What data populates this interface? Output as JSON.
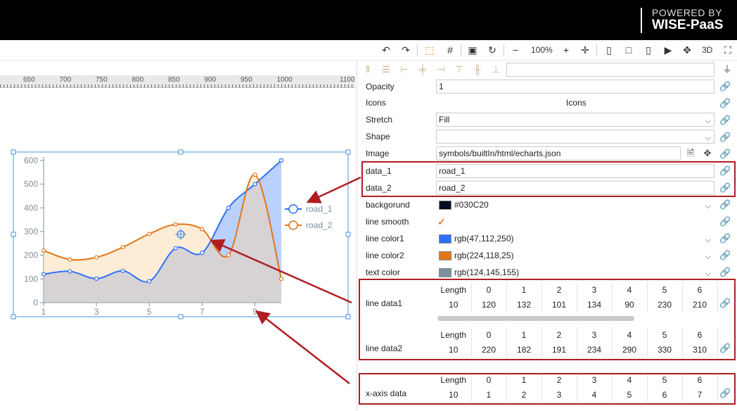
{
  "brand": {
    "line1": "POWERED BY",
    "line2": "WISE-PaaS"
  },
  "toolbar": {
    "undo_icon": "undo-icon",
    "redo_icon": "redo-icon",
    "zoom_label": "100%",
    "view3d_label": "3D"
  },
  "ruler": {
    "labels": [
      "650",
      "700",
      "750",
      "800",
      "850",
      "900",
      "950",
      "1000",
      "1100"
    ]
  },
  "chart_data": {
    "type": "area",
    "x": [
      1,
      2,
      3,
      4,
      5,
      6,
      7,
      8,
      9,
      10
    ],
    "xticks": [
      "1",
      "3",
      "5",
      "7",
      "9"
    ],
    "yticks": [
      "0",
      "100",
      "200",
      "300",
      "400",
      "500",
      "600"
    ],
    "ylim": [
      0,
      600
    ],
    "series": [
      {
        "name": "road_1",
        "color": "#2F70FA",
        "values": [
          120,
          132,
          101,
          134,
          90,
          230,
          210,
          400,
          500,
          600
        ]
      },
      {
        "name": "road_2",
        "color": "#E07619",
        "values": [
          220,
          182,
          191,
          234,
          290,
          330,
          310,
          200,
          540,
          100
        ]
      }
    ],
    "smooth": true,
    "legend": "right"
  },
  "panel": {
    "opacity_label": "Opacity",
    "opacity_value": "1",
    "icons_label": "Icons",
    "icons_value": "Icons",
    "stretch_label": "Stretch",
    "stretch_value": "Fill",
    "shape_label": "Shape",
    "shape_value": "",
    "image_label": "Image",
    "image_value": "symbols/builtIn/html/echarts.json",
    "data1_label": "data_1",
    "data1_value": "road_1",
    "data2_label": "data_2",
    "data2_value": "road_2",
    "bg_label": "backgorund",
    "bg_value": "#030C20",
    "bg_color": "#030C20",
    "smooth_label": "line smooth",
    "lc1_label": "line color1",
    "lc1_value": "rgb(47,112,250)",
    "lc1_color": "#2F70FA",
    "lc2_label": "line color2",
    "lc2_value": "rgb(224,118,25)",
    "lc2_color": "#E07619",
    "tc_label": "text color",
    "tc_value": "rgb(124,145,155)",
    "tc_color": "#7C919B",
    "ld1_label": "line data1",
    "ld2_label": "line data2",
    "xaxis_label": "x-axis data",
    "table_headers": [
      "Length",
      "0",
      "1",
      "2",
      "3",
      "4",
      "5",
      "6"
    ],
    "ld1_row": [
      "10",
      "120",
      "132",
      "101",
      "134",
      "90",
      "230",
      "210"
    ],
    "ld2_row": [
      "10",
      "220",
      "182",
      "191",
      "234",
      "290",
      "330",
      "310"
    ],
    "xaxis_row": [
      "10",
      "1",
      "2",
      "3",
      "4",
      "5",
      "6",
      "7"
    ]
  }
}
